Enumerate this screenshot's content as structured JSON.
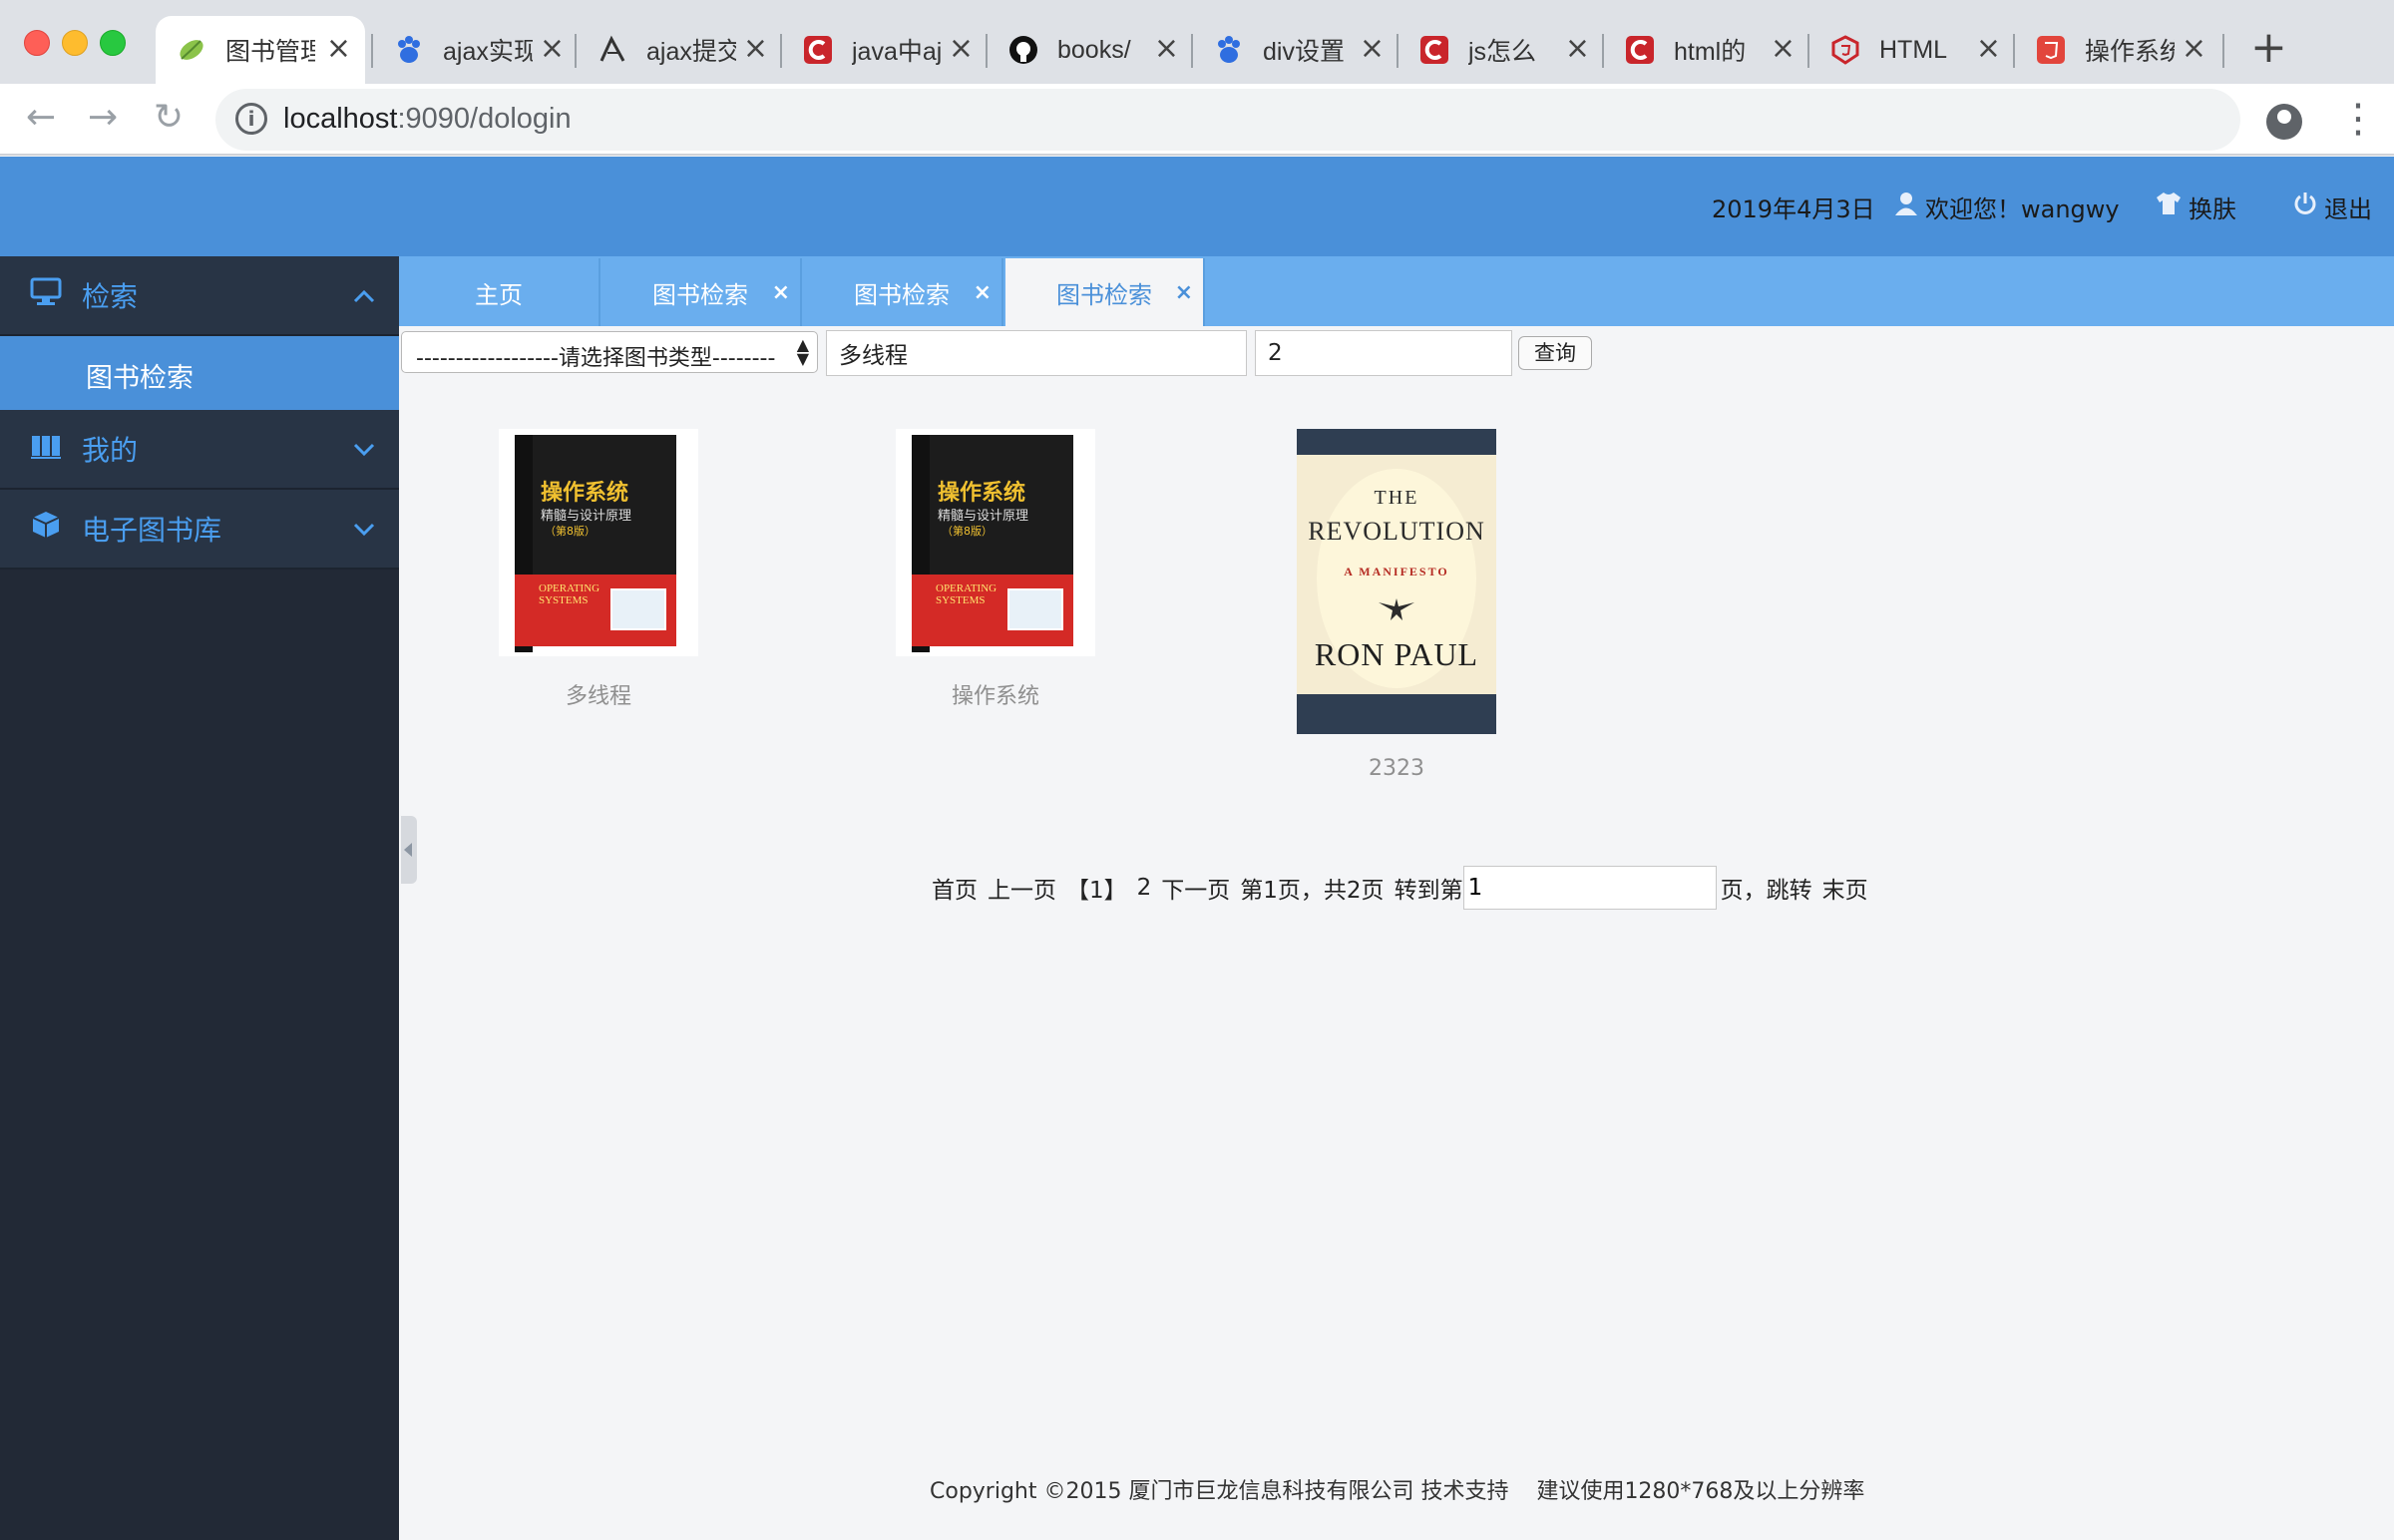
{
  "browser": {
    "tabs": [
      {
        "title": "图书管理",
        "favicon": "spring-leaf-icon",
        "active": true
      },
      {
        "title": "ajax实现",
        "favicon": "baidu-paw-icon"
      },
      {
        "title": "ajax提交",
        "favicon": "zhihu-feather-icon"
      },
      {
        "title": "java中ajax",
        "favicon": "csdn-c-icon"
      },
      {
        "title": "books/",
        "favicon": "github-octocat-icon"
      },
      {
        "title": "div设置",
        "favicon": "baidu-paw-icon"
      },
      {
        "title": "js怎么",
        "favicon": "csdn-c-icon"
      },
      {
        "title": "html的",
        "favicon": "csdn-c-icon"
      },
      {
        "title": "HTML",
        "favicon": "html5-shield-icon"
      },
      {
        "title": "操作系统",
        "favicon": "html5-shield-icon"
      }
    ],
    "tab_close_glyph": "×",
    "new_tab_glyph": "+",
    "url_host": "localhost",
    "url_path": ":9090/dologin",
    "back_glyph": "←",
    "forward_glyph": "→",
    "reload_glyph": "↻",
    "star_glyph": "☆",
    "menu_glyph": "⋮",
    "info_glyph": "i"
  },
  "header": {
    "date": "2019年4月3日",
    "welcome": "欢迎您！wangwy",
    "skin": "换肤",
    "logout": "退出",
    "user_icon_glyph": "👤",
    "skin_icon_glyph": "👕",
    "power_icon_glyph": "⏻",
    "bg_color": "#4a90d9"
  },
  "sidebar": {
    "groups": [
      {
        "label": "检索",
        "icon": "monitor-icon",
        "icon_glyph": "🖥",
        "chevron": "︿",
        "expanded": true,
        "children": [
          {
            "label": "图书检索",
            "active": true
          }
        ]
      },
      {
        "label": "我的",
        "icon": "books-icon",
        "icon_glyph": "📚",
        "chevron": "﹀"
      },
      {
        "label": "电子图书库",
        "icon": "cube-icon",
        "icon_glyph": "⬢",
        "chevron": "﹀"
      }
    ],
    "accent_color": "#4a9ef0",
    "bg_color": "#222936"
  },
  "content_tabs": [
    {
      "label": "主页",
      "closable": false
    },
    {
      "label": "图书检索",
      "closable": true
    },
    {
      "label": "图书检索",
      "closable": true
    },
    {
      "label": "图书检索",
      "closable": true,
      "active": true
    }
  ],
  "content_tab_close_glyph": "×",
  "filter": {
    "type_select_value": "------------------请选择图书类型--------",
    "keyword_value": "多线程",
    "page_value": "2",
    "search_button": "查询"
  },
  "books": [
    {
      "caption": "多线程",
      "cover": {
        "title": "操作系统",
        "subtitle": "精髓与设计原理",
        "edition": "（第8版）",
        "en_line1": "OPERATING",
        "en_line2": "SYSTEMS"
      }
    },
    {
      "caption": "操作系统",
      "cover": {
        "title": "操作系统",
        "subtitle": "精髓与设计原理",
        "edition": "（第8版）",
        "en_line1": "OPERATING",
        "en_line2": "SYSTEMS"
      }
    },
    {
      "caption": "2323",
      "cover": {
        "line1": "THE",
        "line2": "REVOLUTION",
        "line3": "A MANIFESTO",
        "author": "RON PAUL",
        "emblem": "eagle-emblem"
      }
    }
  ],
  "pagination": {
    "first": "首页",
    "prev": "上一页",
    "current": "【1】",
    "page2": "2",
    "next": "下一页",
    "status": "第1页，共2页",
    "goto_prefix": "转到第",
    "goto_value": "1",
    "goto_suffix": "页，跳转",
    "last": "末页"
  },
  "footer": {
    "text": "Copyright ©2015 厦门市巨龙信息科技有限公司 技术支持    建议使用1280*768及以上分辨率"
  }
}
